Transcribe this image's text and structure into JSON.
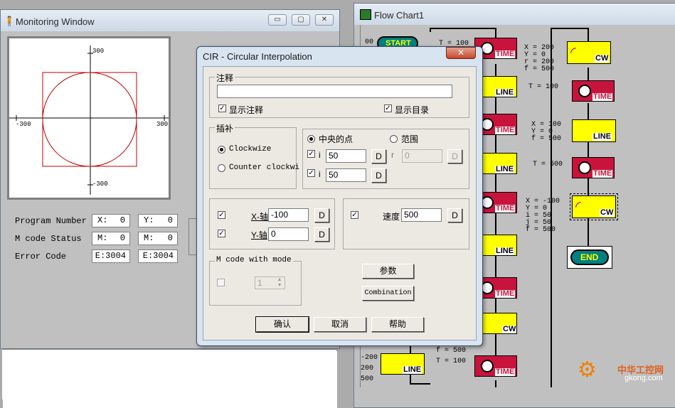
{
  "monitoring": {
    "title": "Monitoring Window",
    "plot": {
      "y_top": "300",
      "y_bottom": "-300",
      "x_left": "-300",
      "x_right": "300"
    },
    "rows": [
      {
        "label": "Program Number",
        "a_key": "X:",
        "a_val": "0",
        "b_key": "Y:",
        "b_val": "0"
      },
      {
        "label": "M code Status",
        "a_key": "M:",
        "a_val": "0",
        "b_key": "M:",
        "b_val": "0"
      },
      {
        "label": "Error Code",
        "a_key": "",
        "a_val": "E:3004",
        "b_key": "",
        "b_val": "E:3004"
      }
    ]
  },
  "flowchart": {
    "title": "Flow Chart1",
    "start_label": "START",
    "end_label": "END",
    "time_label": "TIME",
    "line_label": "LINE",
    "cw_label": "CW",
    "left_partial": [
      "00",
      "-200",
      "200",
      "500"
    ],
    "texts": {
      "t1": "T = 100",
      "cw1": "X = 200\nY = 0\nr = 200\nf = 500",
      "t2": "T = 100",
      "line1": "X = 100\nY = 0\nf = 500",
      "t3": "T = 500",
      "cw2": "X = -100\nY = 0\ni = 50\nj = 50\nf = 500",
      "bottom_f": "f = 500",
      "bottom_t": "T = 100"
    }
  },
  "dialog": {
    "title": "CIR - Circular Interpolation",
    "close": "✕",
    "comment_group": "注释",
    "comment_value": "",
    "show_comment": "显示注释",
    "show_catalog": "显示目录",
    "interp_group": "插补",
    "clockwise": "Clockwize",
    "counter_clockwise": "Counter clockwi",
    "center_point": "中央的点",
    "range": "范围",
    "i_label": "i",
    "i_value": "50",
    "j_label": "i",
    "j_value": "50",
    "r_label": "r",
    "r_value": "0",
    "d_label": "D",
    "x_axis": "X-轴",
    "x_value": "-100",
    "y_axis": "Y-轴",
    "y_value": "0",
    "speed": "速度",
    "speed_value": "500",
    "mcode_group": "M code with mode",
    "mcode_value": "1",
    "params_btn": "参数",
    "combination_btn": "Combination",
    "ok_btn": "确认",
    "cancel_btn": "取消",
    "help_btn": "帮助"
  },
  "watermark": {
    "cn": "中华工控网",
    "url": "gkong.com"
  }
}
